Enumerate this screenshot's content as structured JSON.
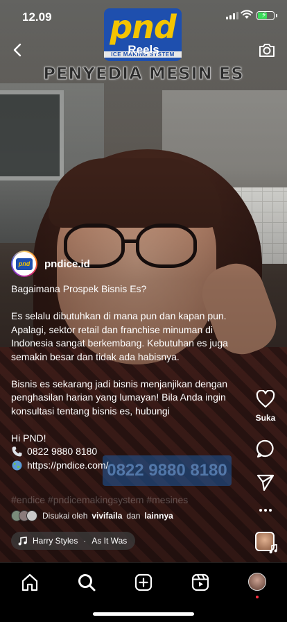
{
  "status_bar": {
    "time": "12.09"
  },
  "header": {
    "title": "Reels"
  },
  "video_overlay": {
    "brand": "pnd",
    "brand_tagline": "ICE MAKING SYSTEM",
    "banner": "PENYEDIA MESIN ES",
    "phone": "0822 9880 8180"
  },
  "post": {
    "author": "pndice.id",
    "author_avatar_text": "pnd",
    "caption": {
      "p1": "Bagaimana Prospek Bisnis Es?",
      "p2": "Es selalu dibutuhkan di mana pun dan kapan pun. Apalagi, sektor retail dan franchise minuman di Indonesia sangat berkembang. Kebutuhan es juga semakin besar dan tidak ada habisnya.",
      "p3": "Bisnis es sekarang jadi bisnis menjanjikan dengan penghasilan harian yang lumayan! Bila Anda ingin konsultasi tentang bisnis es, hubungi",
      "p4_title": "Hi PND!",
      "phone": "0822 9880 8180",
      "url": "https://pndice.com/",
      "hashtags": "#endice #pndicemakingsystem #mesines"
    },
    "likes": {
      "prefix": "Disukai oleh",
      "user": "vivifaila",
      "and": "dan",
      "others": "lainnya"
    },
    "music": {
      "artist": "Harry Styles",
      "separator": "·",
      "song": "As It Was"
    }
  },
  "rail": {
    "like_label": "Suka"
  },
  "icons": {
    "back": "chevron-left-icon",
    "camera": "camera-icon",
    "like": "heart-icon",
    "comment": "comment-icon",
    "share": "send-icon",
    "more": "more-icon",
    "home": "home-icon",
    "search": "search-icon",
    "create": "plus-square-icon",
    "reels": "reels-icon"
  },
  "colors": {
    "brand_blue": "#1e4fae",
    "brand_yellow": "#f4c400",
    "battery": "#3adc5a",
    "notification": "#ff3040"
  }
}
